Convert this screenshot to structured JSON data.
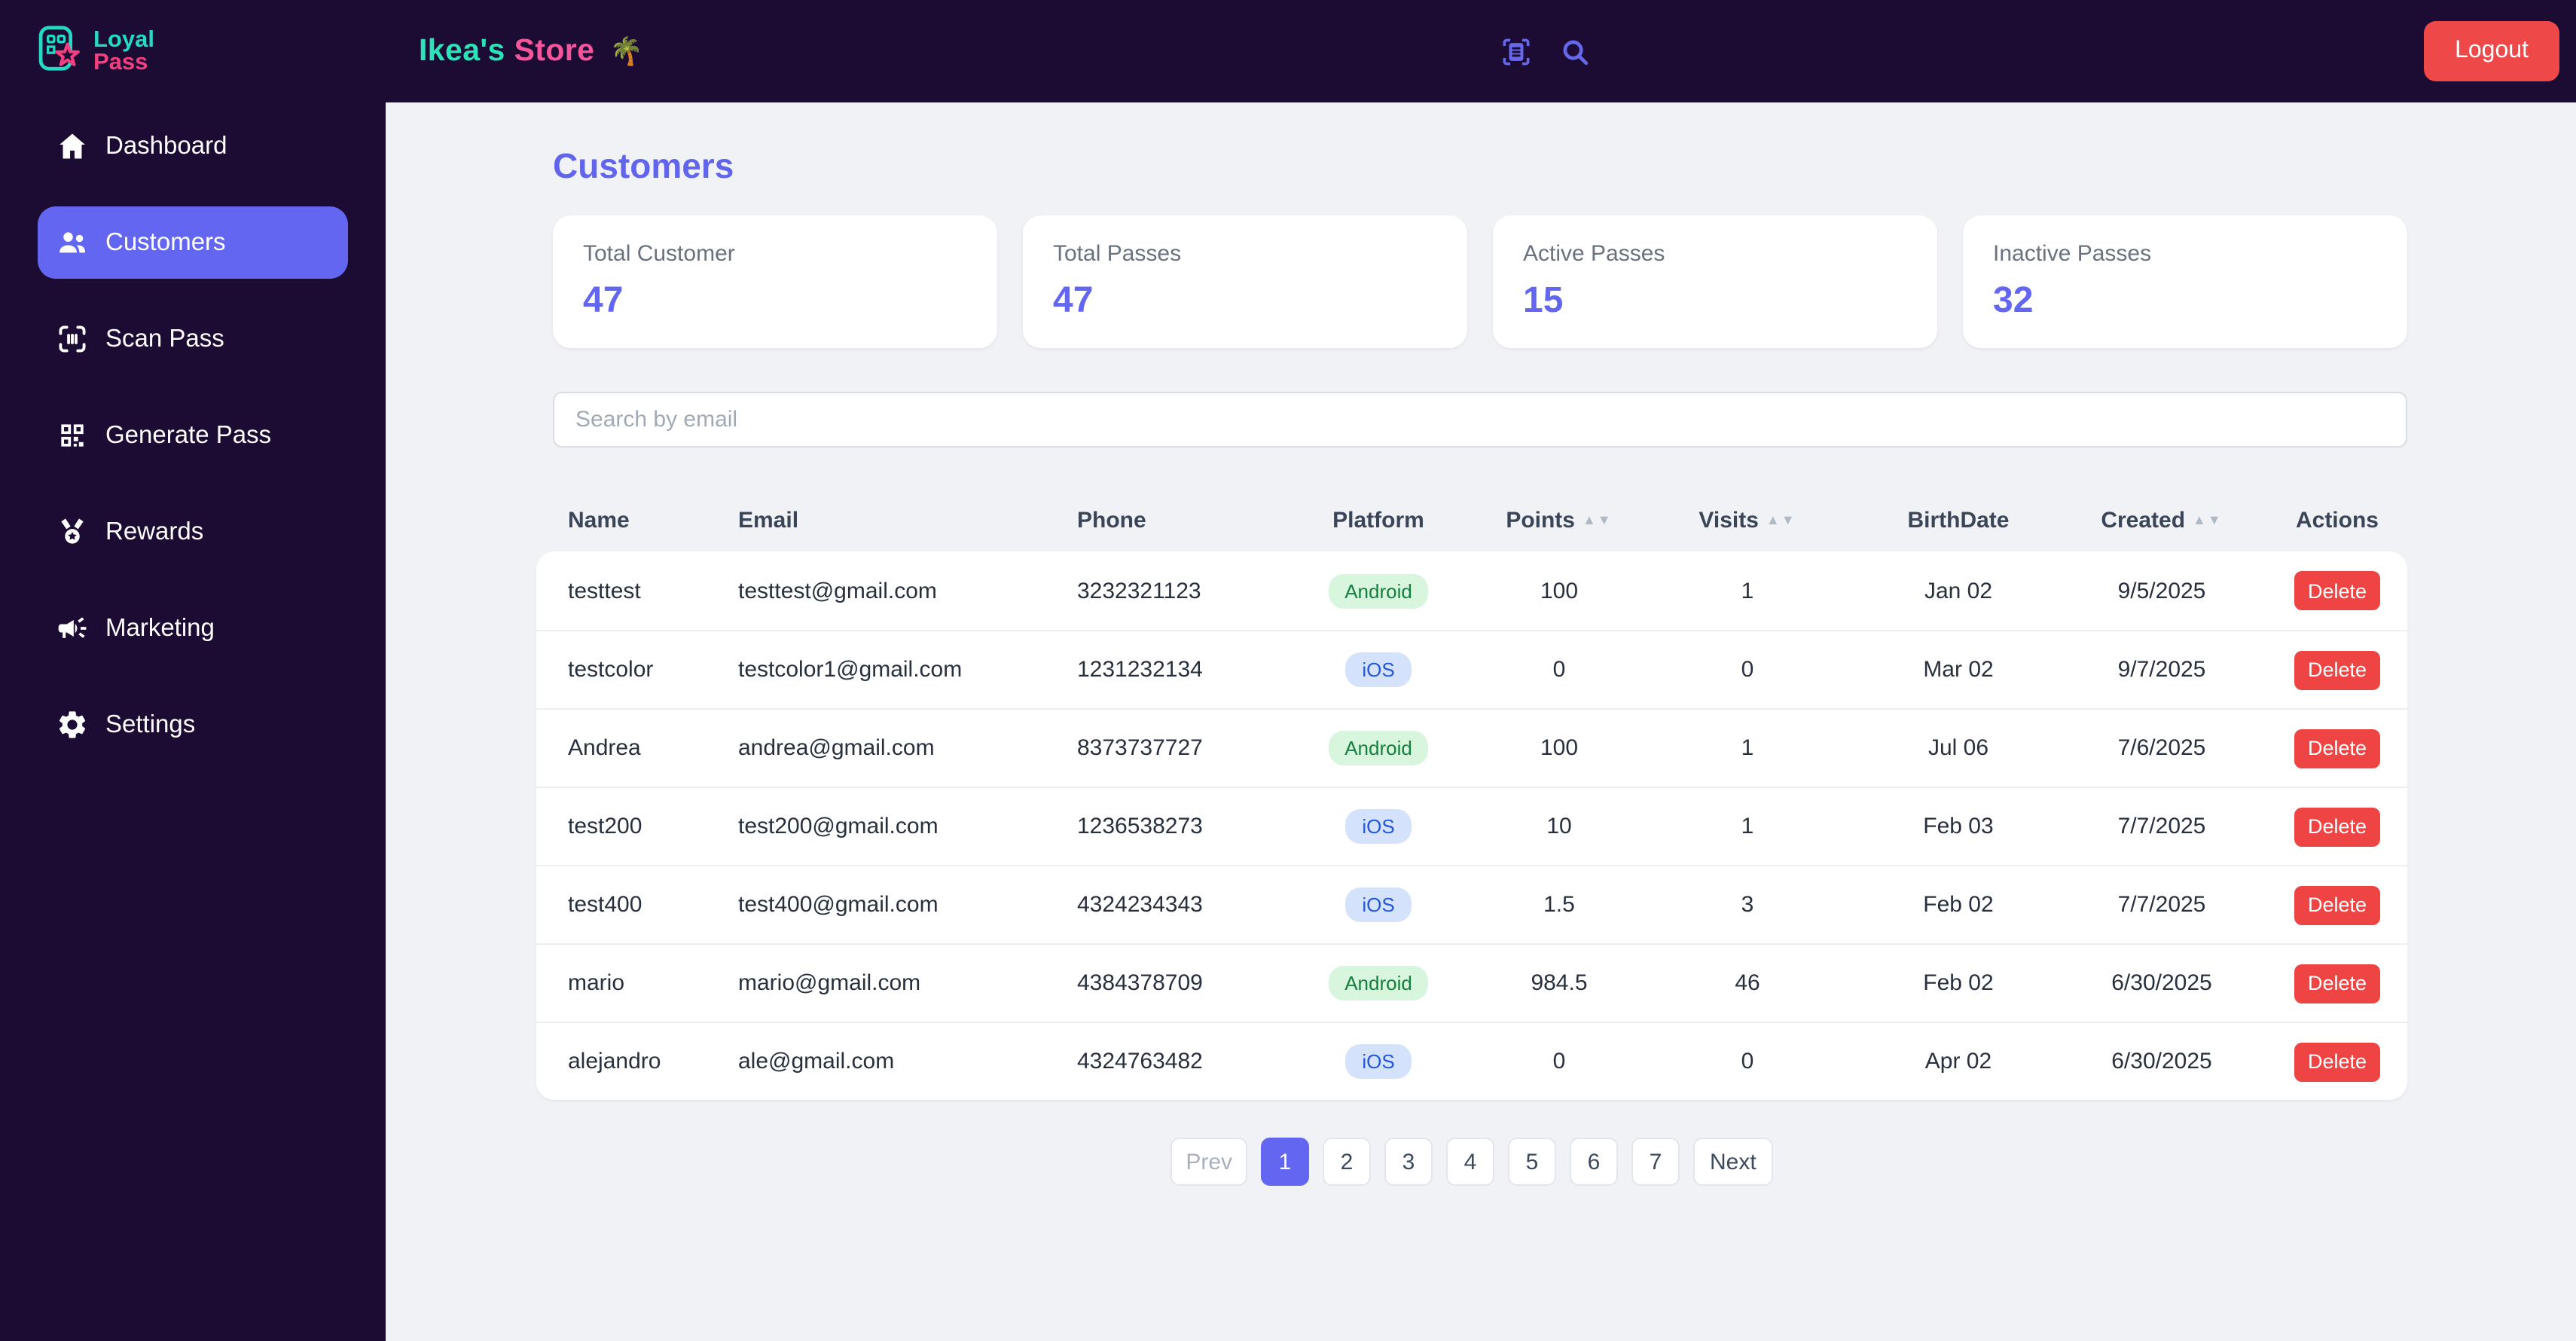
{
  "brand": {
    "line1": "Loyal",
    "line2": "Pass",
    "icon": "loyalpass-logo-icon"
  },
  "topbar": {
    "store_title_primary": "Ikea's",
    "store_title_secondary": "Store",
    "store_title_emoji": "🌴",
    "icons": [
      {
        "name": "scan-document-icon"
      },
      {
        "name": "search-icon"
      }
    ],
    "logout_label": "Logout"
  },
  "sidebar": {
    "items": [
      {
        "label": "Dashboard",
        "icon": "home-icon",
        "active": false
      },
      {
        "label": "Customers",
        "icon": "users-icon",
        "active": true
      },
      {
        "label": "Scan Pass",
        "icon": "scan-icon",
        "active": false
      },
      {
        "label": "Generate Pass",
        "icon": "qr-icon",
        "active": false
      },
      {
        "label": "Rewards",
        "icon": "medal-icon",
        "active": false
      },
      {
        "label": "Marketing",
        "icon": "megaphone-icon",
        "active": false
      },
      {
        "label": "Settings",
        "icon": "gear-icon",
        "active": false
      }
    ]
  },
  "page": {
    "title": "Customers"
  },
  "stats": [
    {
      "label": "Total Customer",
      "value": "47"
    },
    {
      "label": "Total Passes",
      "value": "47"
    },
    {
      "label": "Active Passes",
      "value": "15"
    },
    {
      "label": "Inactive Passes",
      "value": "32"
    }
  ],
  "search": {
    "placeholder": "Search by email"
  },
  "table": {
    "columns": [
      {
        "label": "Name",
        "sortable": false,
        "align": "left",
        "key": "name"
      },
      {
        "label": "Email",
        "sortable": false,
        "align": "left",
        "key": "email"
      },
      {
        "label": "Phone",
        "sortable": false,
        "align": "left",
        "key": "phone"
      },
      {
        "label": "Platform",
        "sortable": false,
        "align": "center",
        "key": "platform"
      },
      {
        "label": "Points",
        "sortable": true,
        "align": "center",
        "key": "points"
      },
      {
        "label": "Visits",
        "sortable": true,
        "align": "center",
        "key": "visits"
      },
      {
        "label": "BirthDate",
        "sortable": false,
        "align": "center",
        "key": "birthdate"
      },
      {
        "label": "Created",
        "sortable": true,
        "align": "center",
        "key": "created"
      },
      {
        "label": "Actions",
        "sortable": false,
        "align": "center",
        "key": "actions"
      }
    ],
    "sort_arrows": "▲▼",
    "delete_label": "Delete",
    "rows": [
      {
        "name": "testtest",
        "email": "testtest@gmail.com",
        "phone": "3232321123",
        "platform": "Android",
        "points": "100",
        "visits": "1",
        "birthdate": "Jan 02",
        "created": "9/5/2025"
      },
      {
        "name": "testcolor",
        "email": "testcolor1@gmail.com",
        "phone": "1231232134",
        "platform": "iOS",
        "points": "0",
        "visits": "0",
        "birthdate": "Mar 02",
        "created": "9/7/2025"
      },
      {
        "name": "Andrea",
        "email": "andrea@gmail.com",
        "phone": "8373737727",
        "platform": "Android",
        "points": "100",
        "visits": "1",
        "birthdate": "Jul 06",
        "created": "7/6/2025"
      },
      {
        "name": "test200",
        "email": "test200@gmail.com",
        "phone": "1236538273",
        "platform": "iOS",
        "points": "10",
        "visits": "1",
        "birthdate": "Feb 03",
        "created": "7/7/2025"
      },
      {
        "name": "test400",
        "email": "test400@gmail.com",
        "phone": "4324234343",
        "platform": "iOS",
        "points": "1.5",
        "visits": "3",
        "birthdate": "Feb 02",
        "created": "7/7/2025"
      },
      {
        "name": "mario",
        "email": "mario@gmail.com",
        "phone": "4384378709",
        "platform": "Android",
        "points": "984.5",
        "visits": "46",
        "birthdate": "Feb 02",
        "created": "6/30/2025"
      },
      {
        "name": "alejandro",
        "email": "ale@gmail.com",
        "phone": "4324763482",
        "platform": "iOS",
        "points": "0",
        "visits": "0",
        "birthdate": "Apr 02",
        "created": "6/30/2025"
      }
    ]
  },
  "pagination": {
    "prev_label": "Prev",
    "pages": [
      "1",
      "2",
      "3",
      "4",
      "5",
      "6",
      "7"
    ],
    "active_page": "1",
    "next_label": "Next"
  },
  "colors": {
    "accent_indigo": "#6366f1",
    "sidebar_bg": "#1c0b33",
    "page_bg": "#f1f2f5",
    "brand_teal": "#2be3b8",
    "brand_pink": "#f4559b",
    "logout_red": "#ef4848",
    "delete_red": "#ef4444",
    "android_badge_bg": "#d8f5de",
    "android_badge_text": "#15803d",
    "ios_badge_bg": "#d5e2fc",
    "ios_badge_text": "#2356d9"
  }
}
